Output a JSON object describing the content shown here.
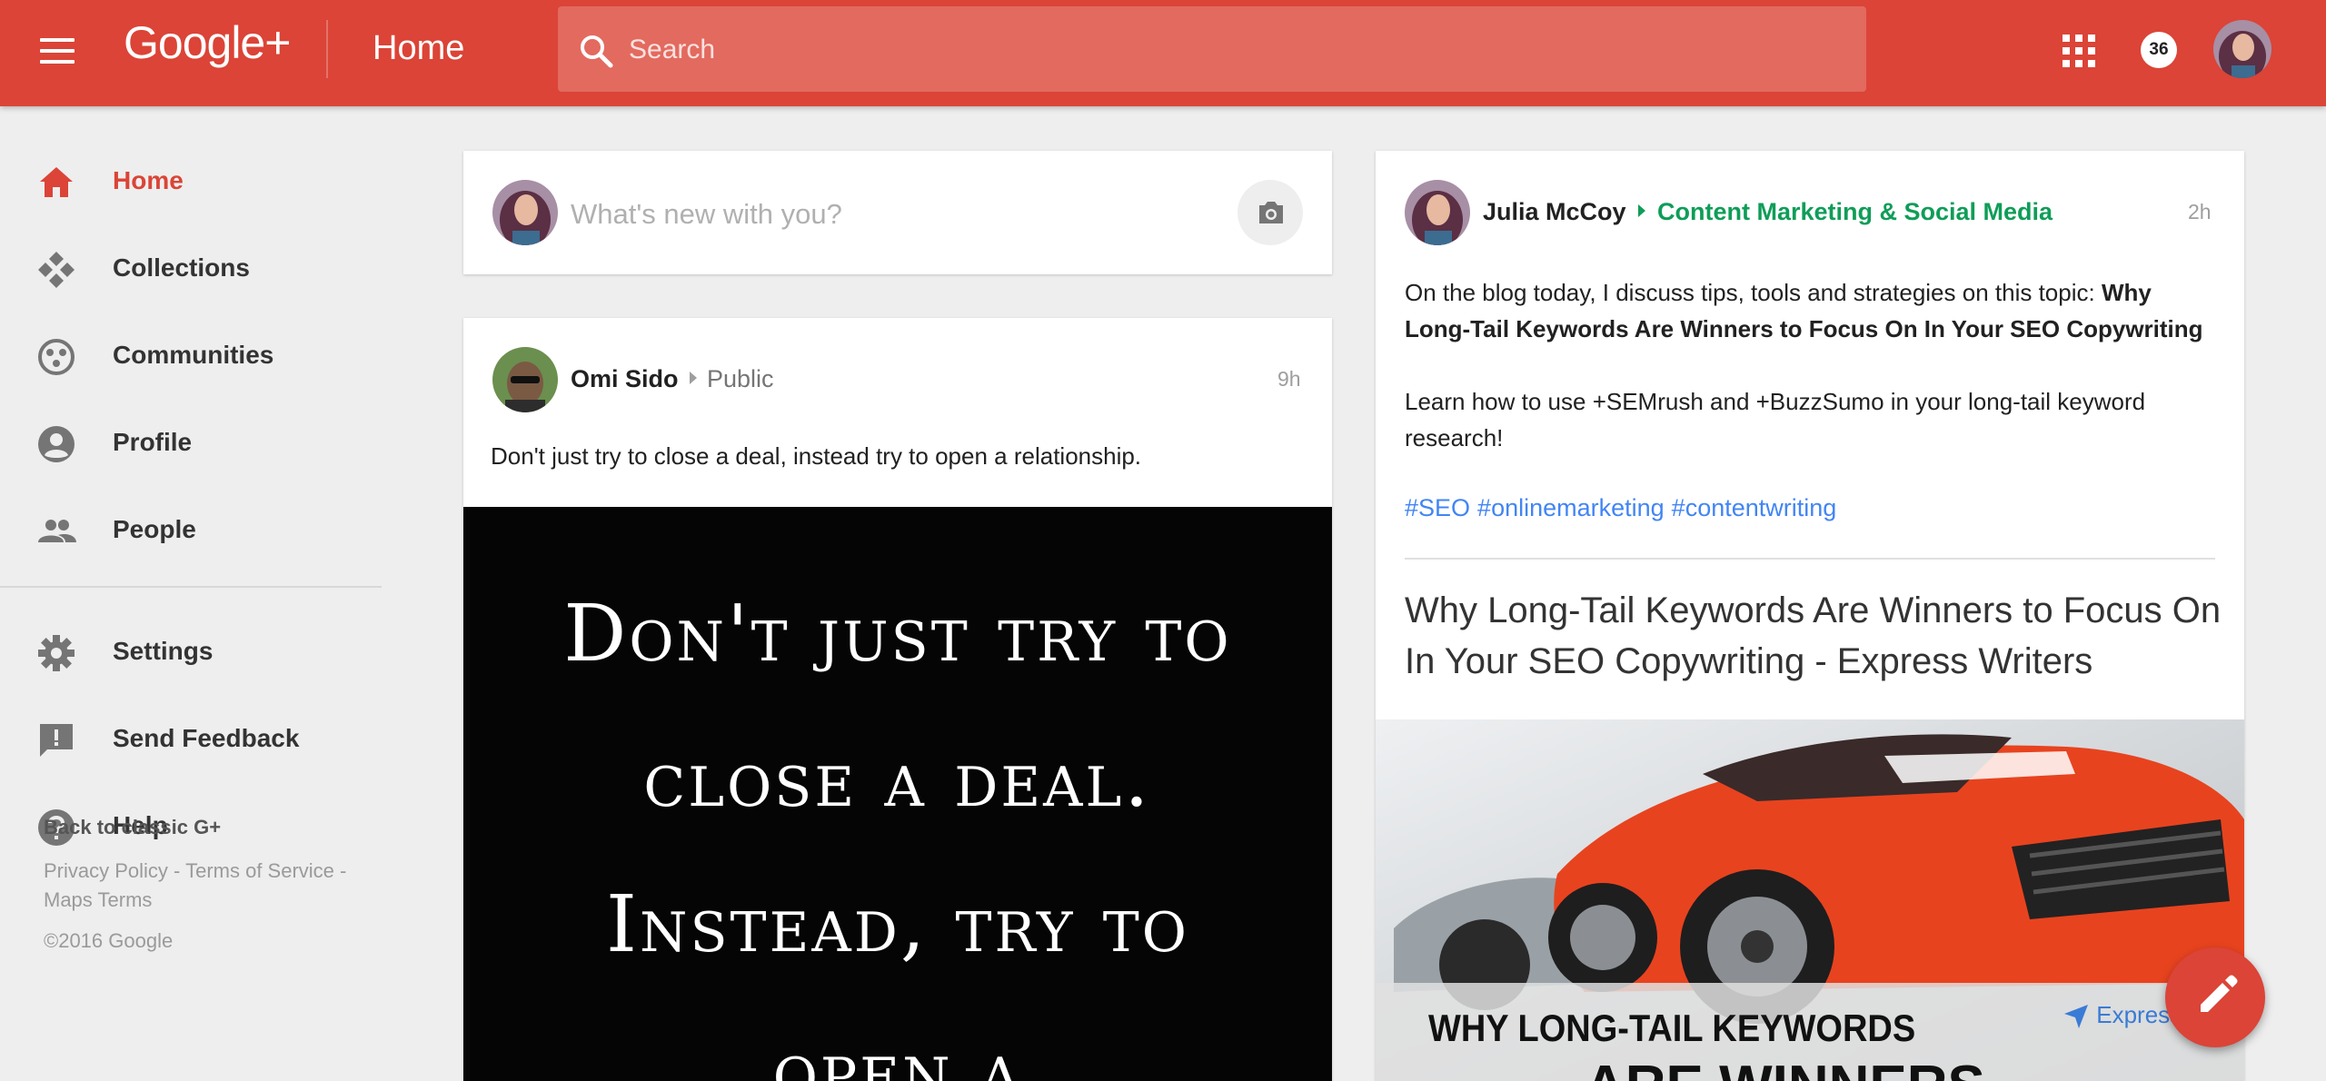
{
  "header": {
    "logo": "Google+",
    "title": "Home",
    "search_placeholder": "Search",
    "notification_count": "36",
    "accent_color": "#db4437"
  },
  "sidebar": {
    "items": [
      {
        "label": "Home",
        "icon": "home-icon",
        "active": true
      },
      {
        "label": "Collections",
        "icon": "collections-icon"
      },
      {
        "label": "Communities",
        "icon": "communities-icon"
      },
      {
        "label": "Profile",
        "icon": "profile-icon"
      },
      {
        "label": "People",
        "icon": "people-icon"
      },
      {
        "label": "Settings",
        "icon": "gear-icon"
      },
      {
        "label": "Send Feedback",
        "icon": "feedback-icon"
      },
      {
        "label": "Help",
        "icon": "help-icon"
      }
    ],
    "back_to_classic": "Back to classic G+",
    "footer": {
      "privacy": "Privacy Policy",
      "terms": "Terms of Service",
      "maps_terms": "Maps Terms",
      "separator": " - "
    },
    "copyright": "©2016 Google"
  },
  "composer": {
    "placeholder": "What's new with you?"
  },
  "posts": [
    {
      "author": "Omi Sido",
      "audience": "Public",
      "time": "9h",
      "text": "Don't just try to close a deal, instead try to open a relationship.",
      "image_lines": [
        "Don't just try to",
        "close a deal.",
        "Instead, try to",
        "open a"
      ]
    },
    {
      "author": "Julia McCoy",
      "community": "Content Marketing & Social Media",
      "time": "2h",
      "text_intro": "On the blog today, I discuss tips, tools and strategies on this topic: ",
      "text_bold": "Why Long-Tail Keywords Are Winners to Focus On In Your SEO Copywriting",
      "text2": "Learn how to use +SEMrush and +BuzzSumo in your long-tail keyword research!",
      "hashtags": [
        "#SEO",
        "#onlinemarketing",
        "#contentwriting"
      ],
      "link_title": "Why Long-Tail Keywords Are Winners to Focus On In Your SEO Copywriting - Express Writers",
      "image_banner_line1": "WHY LONG-TAIL KEYWORDS",
      "image_banner_line2": "ARE WINNERS",
      "image_brand": "Express"
    }
  ]
}
